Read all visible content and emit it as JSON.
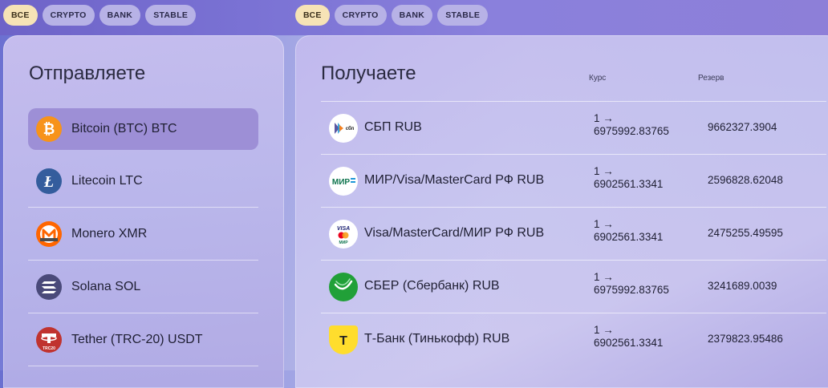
{
  "filters_left": [
    "ВСЕ",
    "CRYPTO",
    "BANK",
    "STABLE"
  ],
  "filters_right": [
    "ВСЕ",
    "CRYPTO",
    "BANK",
    "STABLE"
  ],
  "active_filter": "ВСЕ",
  "send": {
    "title": "Отправляете",
    "items": [
      {
        "label": "Bitcoin (BTC) BTC",
        "icon": "bitcoin-icon",
        "selected": true
      },
      {
        "label": "Litecoin LTC",
        "icon": "litecoin-icon"
      },
      {
        "label": "Monero XMR",
        "icon": "monero-icon"
      },
      {
        "label": "Solana SOL",
        "icon": "solana-icon"
      },
      {
        "label": "Tether (TRC-20) USDT",
        "icon": "tether-icon"
      }
    ]
  },
  "receive": {
    "title": "Получаете",
    "col_rate": "Курс",
    "col_reserve": "Резерв",
    "items": [
      {
        "name": "СБП RUB",
        "icon": "sbp-icon",
        "rate_line1": "1 →",
        "rate_line2": "6975992.83765",
        "reserve": "9662327.3904"
      },
      {
        "name": "МИР/Visa/MasterCard РФ RUB",
        "icon": "mir-icon",
        "rate_line1": "1 →",
        "rate_line2": "6902561.3341",
        "reserve": "2596828.62048"
      },
      {
        "name": "Visa/MasterCard/МИР РФ RUB",
        "icon": "visa-mastercard-icon",
        "rate_line1": "1 →",
        "rate_line2": "6902561.3341",
        "reserve": "2475255.49595"
      },
      {
        "name": "СБЕР (Сбербанк) RUB",
        "icon": "sber-icon",
        "rate_line1": "1 →",
        "rate_line2": "6975992.83765",
        "reserve": "3241689.0039"
      },
      {
        "name": "Т-Банк (Тинькофф) RUB",
        "icon": "tbank-icon",
        "rate_line1": "1 →",
        "rate_line2": "6902561.3341",
        "reserve": "2379823.95486"
      }
    ]
  },
  "icon_text": {
    "sbp": "сбп",
    "mir": "МИР",
    "visa": "VISA",
    "visa_sub": "МИР",
    "tbank": "Т",
    "tether_sub": "TRC20"
  },
  "colors": {
    "chip_active": "#f6e3b6",
    "chip": "#b7b2e6",
    "selected_row": "#9d8fd6",
    "bitcoin": "#f7931a",
    "litecoin": "#345d9d",
    "monero": "#ff6600",
    "solana_bg": "#4a4a7a",
    "tether": "#c0332f",
    "sber": "#21a038",
    "tbank": "#ffdd2d"
  }
}
